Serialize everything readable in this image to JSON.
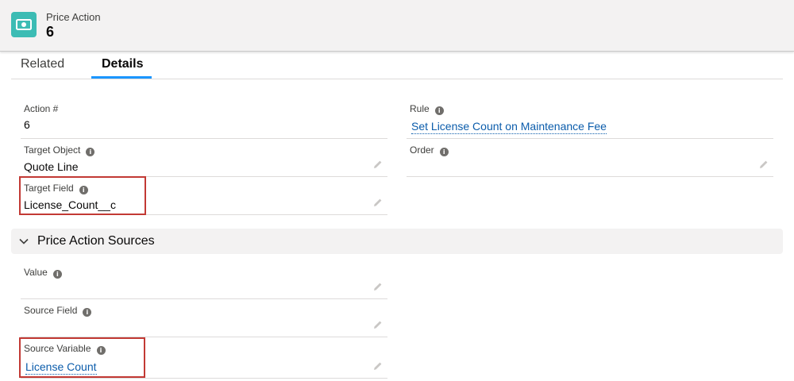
{
  "header": {
    "object_type": "Price Action",
    "record_name": "6",
    "icon": "money-icon",
    "icon_color": "#3cbcb4"
  },
  "tabs": [
    {
      "label": "Related",
      "active": false
    },
    {
      "label": "Details",
      "active": true
    }
  ],
  "details": {
    "action_number": {
      "label": "Action #",
      "value": "6"
    },
    "rule": {
      "label": "Rule",
      "value": "Set License Count on Maintenance Fee"
    },
    "target_object": {
      "label": "Target Object",
      "value": "Quote Line"
    },
    "order": {
      "label": "Order",
      "value": ""
    },
    "target_field": {
      "label": "Target Field",
      "value": "License_Count__c"
    }
  },
  "sources_section": {
    "title": "Price Action Sources",
    "value": {
      "label": "Value",
      "value": ""
    },
    "source_field": {
      "label": "Source Field",
      "value": ""
    },
    "source_variable": {
      "label": "Source Variable",
      "value": "License Count"
    }
  },
  "colors": {
    "link": "#0b5cab",
    "tab_active_underline": "#1b96ff",
    "highlight_box": "#c23934",
    "header_bg": "#f3f2f2"
  }
}
